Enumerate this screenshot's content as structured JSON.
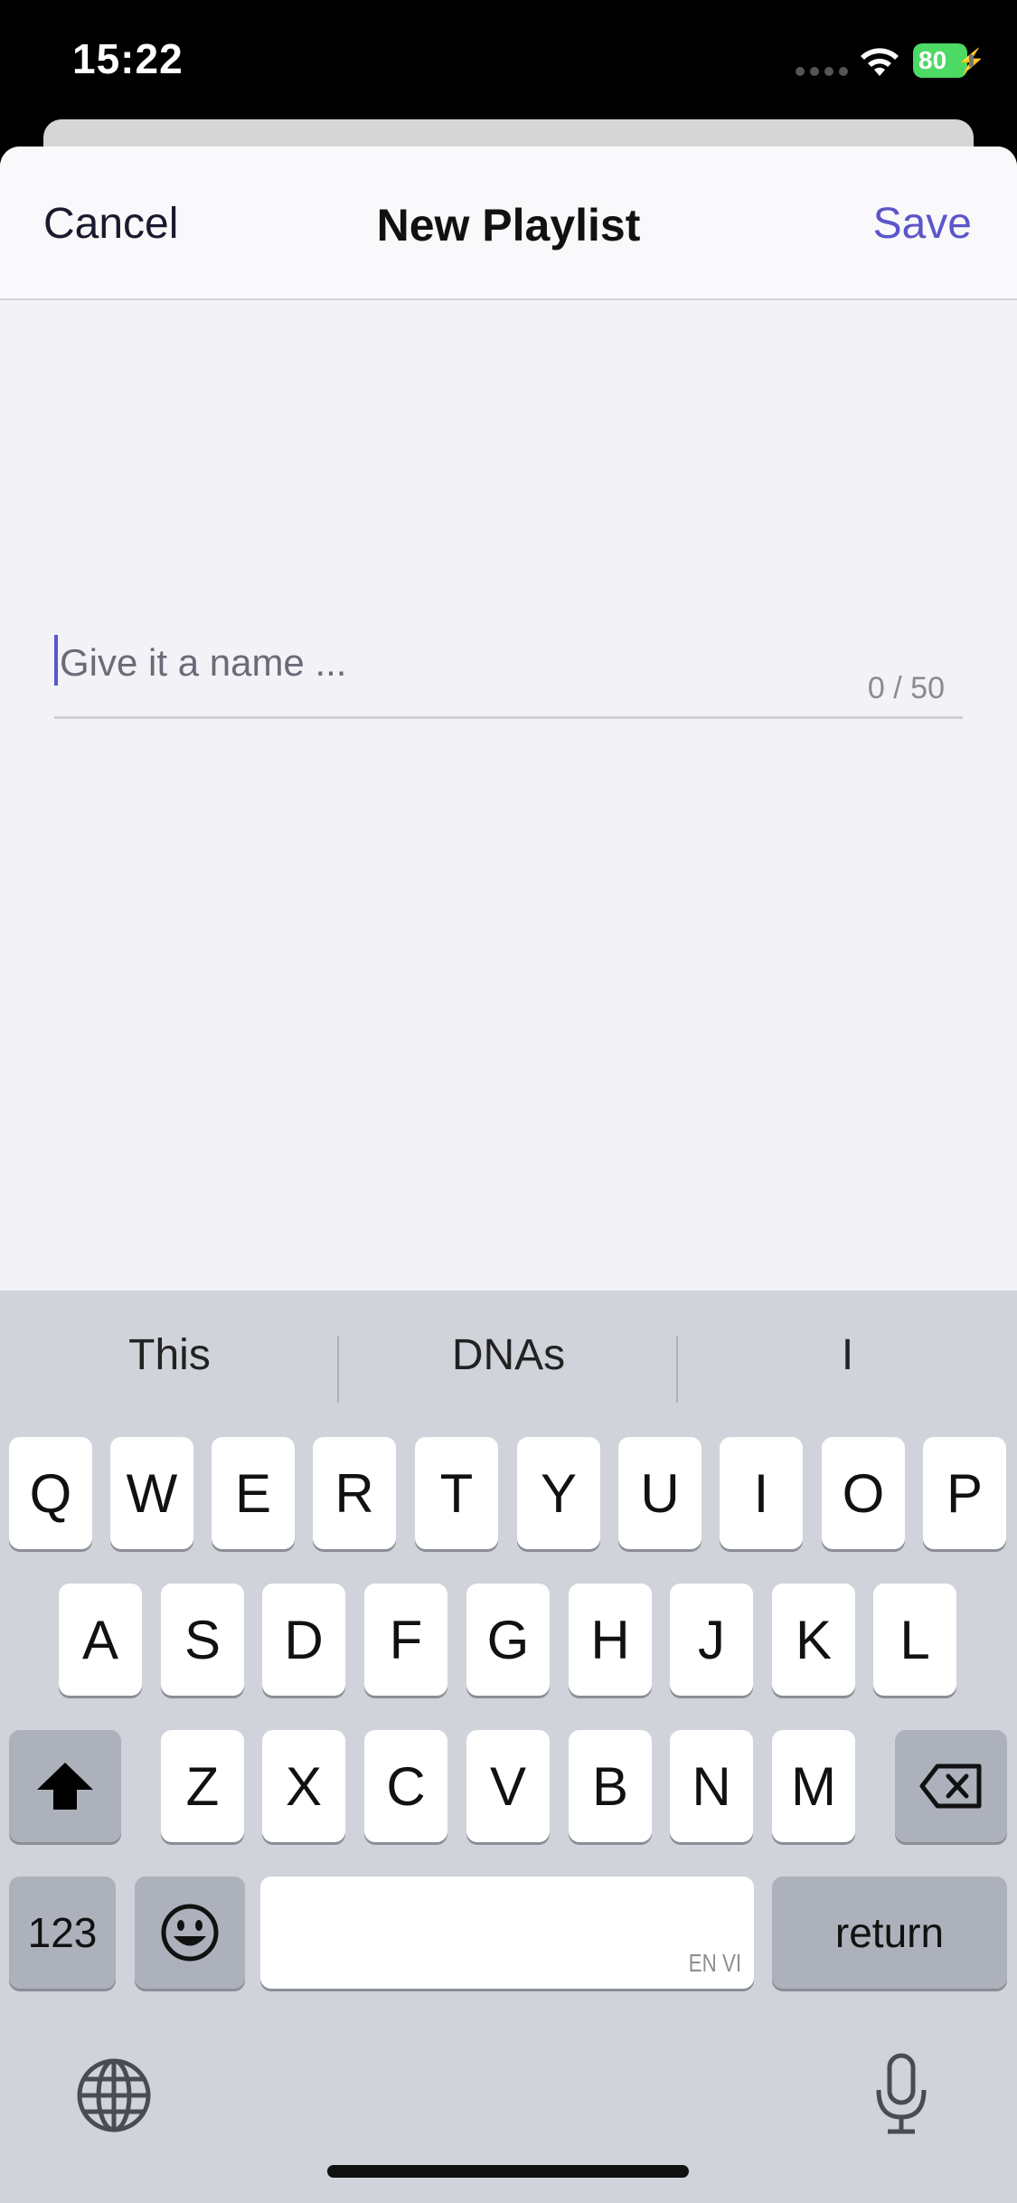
{
  "status_bar": {
    "time": "15:22",
    "battery": "80"
  },
  "nav": {
    "cancel": "Cancel",
    "title": "New Playlist",
    "save": "Save"
  },
  "name_field": {
    "placeholder": "Give it a name ...",
    "value": "",
    "counter": "0 / 50"
  },
  "keyboard": {
    "suggestions": [
      "This",
      "DNAs",
      "I"
    ],
    "row1": [
      "Q",
      "W",
      "E",
      "R",
      "T",
      "Y",
      "U",
      "I",
      "O",
      "P"
    ],
    "row2": [
      "A",
      "S",
      "D",
      "F",
      "G",
      "H",
      "J",
      "K",
      "L"
    ],
    "row3": [
      "Z",
      "X",
      "C",
      "V",
      "B",
      "N",
      "M"
    ],
    "numbers_key": "123",
    "return_key": "return",
    "space_languages": "EN VI"
  },
  "colors": {
    "accent": "#5b56c9",
    "battery": "#4cd964",
    "keyboard_bg": "#d1d3db"
  }
}
